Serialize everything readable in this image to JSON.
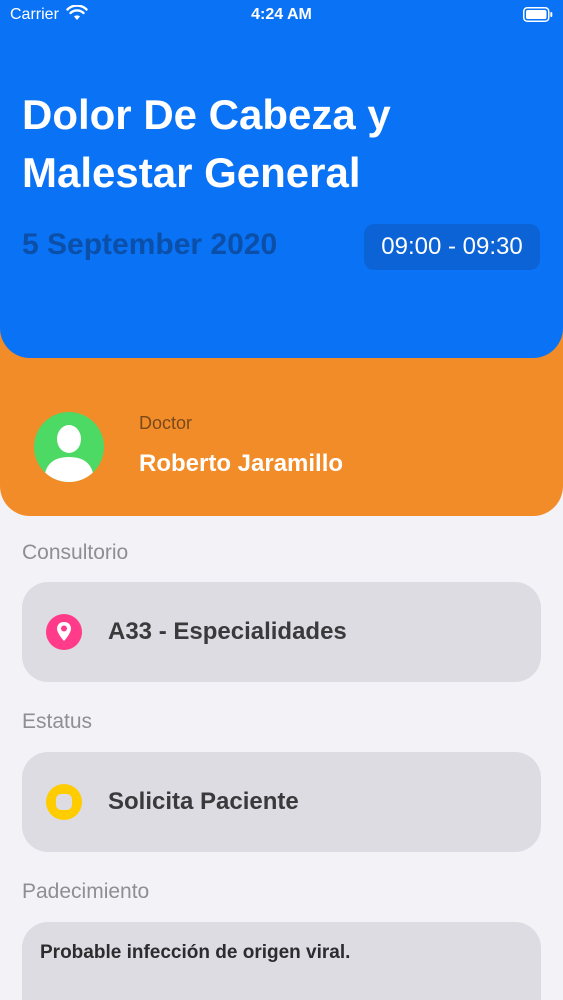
{
  "status_bar": {
    "carrier": "Carrier",
    "time": "4:24 AM"
  },
  "appointment": {
    "title": "Dolor De Cabeza y Malestar General",
    "date": "5 September 2020",
    "time_range": "09:00 - 09:30"
  },
  "doctor": {
    "label": "Doctor",
    "name": "Roberto Jaramillo"
  },
  "office": {
    "label": "Consultorio",
    "value": "A33 - Especialidades",
    "icon": "location-pin-icon"
  },
  "status": {
    "label": "Estatus",
    "value": "Solicita Paciente",
    "icon": "status-circle-icon"
  },
  "condition": {
    "label": "Padecimiento",
    "value": "Probable infección de origen viral."
  },
  "colors": {
    "header": "#0a73f5",
    "doctor_card": "#f28c28",
    "avatar": "#4cd964",
    "pin": "#ff3b8a",
    "status": "#ffcc00"
  }
}
